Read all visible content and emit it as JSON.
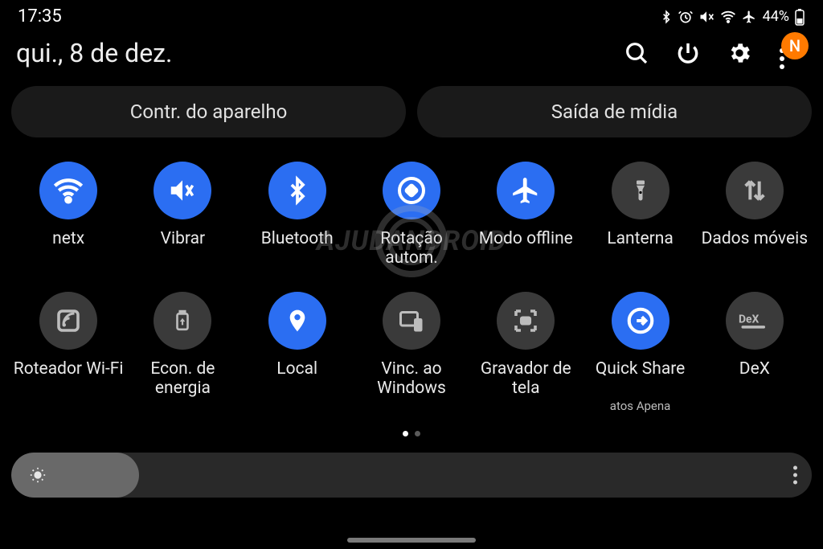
{
  "status": {
    "time": "17:35",
    "battery_text": "44%"
  },
  "header": {
    "date": "qui., 8 de dez.",
    "avatar_initial": "N"
  },
  "chips": {
    "device_controls": "Contr. do aparelho",
    "media_output": "Saída de mídia"
  },
  "tiles": [
    {
      "id": "wifi",
      "label": "netx",
      "active": true,
      "icon": "wifi"
    },
    {
      "id": "sound",
      "label": "Vibrar",
      "active": true,
      "icon": "vibrate"
    },
    {
      "id": "bluetooth",
      "label": "Bluetooth",
      "active": true,
      "icon": "bluetooth"
    },
    {
      "id": "rotation",
      "label": "Rotação autom.",
      "active": true,
      "icon": "rotate"
    },
    {
      "id": "airplane",
      "label": "Modo offline",
      "active": true,
      "icon": "airplane"
    },
    {
      "id": "flashlight",
      "label": "Lanterna",
      "active": false,
      "icon": "flashlight"
    },
    {
      "id": "mobiledata",
      "label": "Dados móveis",
      "active": false,
      "icon": "data"
    },
    {
      "id": "hotspot",
      "label": "Roteador Wi-Fi",
      "active": false,
      "icon": "hotspot"
    },
    {
      "id": "powersave",
      "label": "Econ. de energia",
      "active": false,
      "icon": "battery"
    },
    {
      "id": "location",
      "label": "Local",
      "active": true,
      "icon": "location"
    },
    {
      "id": "linkwindows",
      "label": "Vinc. ao Windows",
      "active": false,
      "icon": "link-windows"
    },
    {
      "id": "screenrec",
      "label": "Gravador de tela",
      "active": false,
      "icon": "screen-record"
    },
    {
      "id": "quickshare",
      "label": "Quick Share",
      "sub": "atos      Apena",
      "active": true,
      "icon": "quickshare"
    },
    {
      "id": "dex",
      "label": "DeX",
      "active": false,
      "icon": "dex"
    }
  ],
  "brightness": {
    "percent": 16
  },
  "watermark": "AJUDANDROID"
}
